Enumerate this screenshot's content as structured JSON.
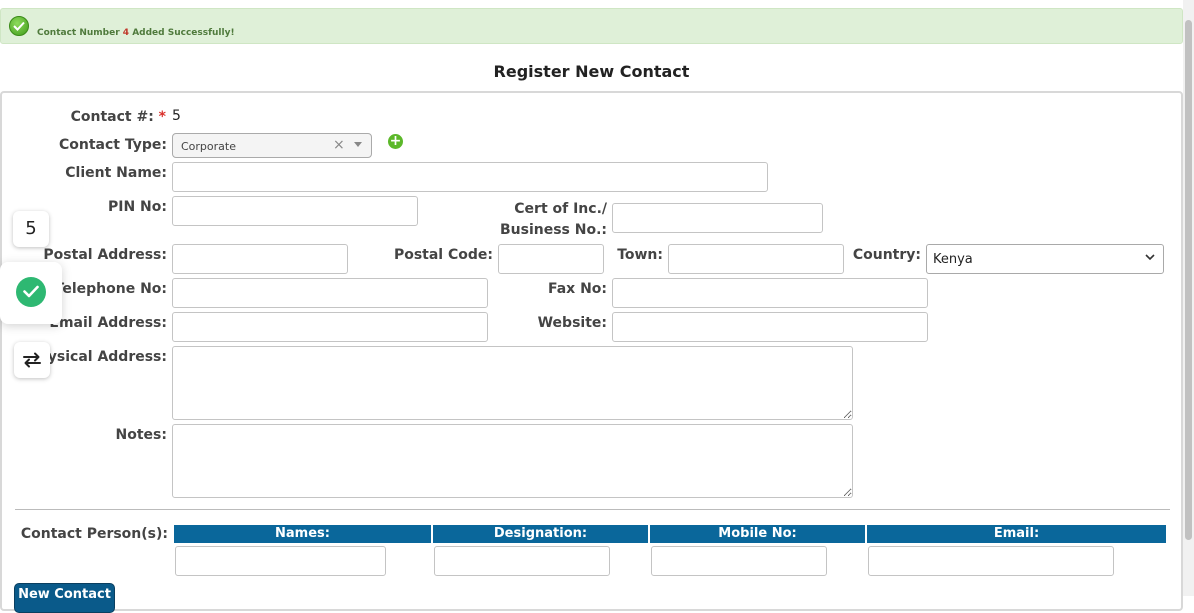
{
  "alert": {
    "prefix": "Contact Number",
    "number": "4",
    "suffix": "Added Successfully!"
  },
  "page_title": "Register New Contact",
  "form": {
    "contact_no_label": "Contact #:",
    "required_mark": "*",
    "contact_no_value": "5",
    "contact_type_label": "Contact Type:",
    "contact_type_value": "Corporate",
    "clear_glyph": "×",
    "add_glyph": "+",
    "client_name_label": "Client Name:",
    "pin_label": "PIN No:",
    "cert_label_line1": "Cert of Inc./",
    "cert_label_line2": "Business No.:",
    "postal_address_label": "Postal Address:",
    "postal_code_label": "Postal Code:",
    "town_label": "Town:",
    "country_label": "Country:",
    "country_value": "Kenya",
    "telephone_label": "Telephone No:",
    "fax_label": "Fax No:",
    "email_label": "Email Address:",
    "website_label": "Website:",
    "physical_address_label": "Physical Address:",
    "notes_label": "Notes:"
  },
  "contact_persons": {
    "label": "Contact Person(s):",
    "columns": [
      "Names:",
      "Designation:",
      "Mobile No:",
      "Email:"
    ]
  },
  "new_contact_button": "New Contact",
  "widget": {
    "count": "5"
  },
  "colors": {
    "alert_bg": "#dff0d8",
    "table_header": "#0a679b",
    "required": "#d9302b",
    "success_green": "#2eb872"
  }
}
